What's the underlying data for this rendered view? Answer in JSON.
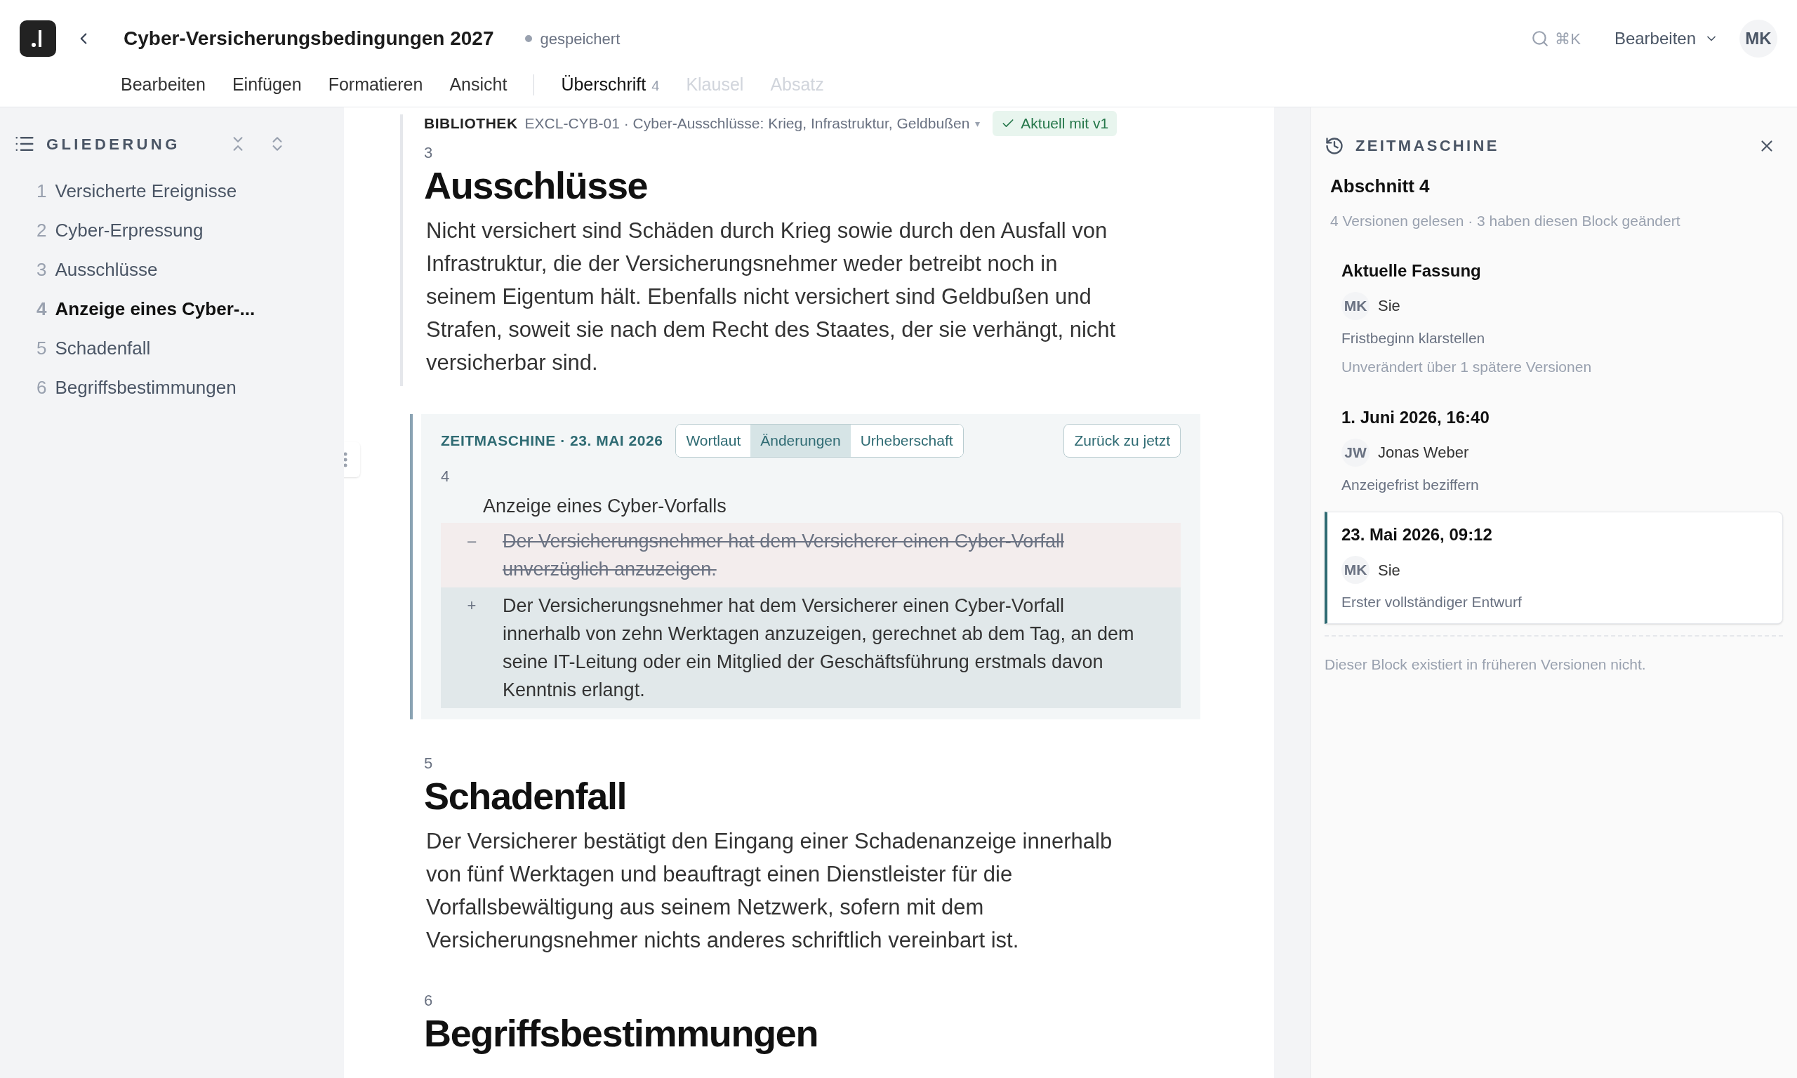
{
  "document": {
    "title": "Cyber-Versicherungsbedingungen 2027",
    "status": "gespeichert"
  },
  "search": {
    "shortcut": "⌘K"
  },
  "mode_menu": {
    "label": "Bearbeiten"
  },
  "user": {
    "initials": "MK"
  },
  "menu": [
    "Bearbeiten",
    "Einfügen",
    "Formatieren",
    "Ansicht"
  ],
  "block_types": [
    {
      "label": "Überschrift",
      "count": "4",
      "selected": true,
      "disabled": false
    },
    {
      "label": "Klausel",
      "selected": false,
      "disabled": true
    },
    {
      "label": "Absatz",
      "selected": false,
      "disabled": true
    }
  ],
  "outline": {
    "title": "GLIEDERUNG",
    "items": [
      {
        "number": "1",
        "label": "Versicherte Ereignisse",
        "selected": false
      },
      {
        "number": "2",
        "label": "Cyber-Erpressung",
        "selected": false
      },
      {
        "number": "3",
        "label": "Ausschlüsse",
        "selected": false
      },
      {
        "number": "4",
        "label": "Anzeige eines Cyber-...",
        "selected": true
      },
      {
        "number": "5",
        "label": "Schadenfall",
        "selected": false
      },
      {
        "number": "6",
        "label": "Begriffsbestimmungen",
        "selected": false
      }
    ]
  },
  "sections": [
    {
      "kind": "heading",
      "number": "3",
      "title": "Ausschlüsse",
      "text": "Nicht versichert sind Schäden durch Krieg sowie durch den Ausfall von Infrastruktur, die der Versicherungsnehmer weder betreibt noch in seinem Eigentum hält. Ebenfalls nicht versichert sind Geldbußen und Strafen, soweit sie nach dem Recht des Staates, der sie verhängt, nicht versicherbar sind.",
      "library": {
        "label": "BIBLIOTHEK",
        "reference": "EXCL-CYB-01 · Cyber-Ausschlüsse: Krieg, Infrastruktur, Geldbußen",
        "status": "Aktuell mit v1",
        "caret": "▾"
      }
    },
    {
      "kind": "history",
      "header": "ZEITMASCHINE · 23. MAI 2026",
      "tabs": [
        {
          "label": "Wortlaut",
          "selected": false
        },
        {
          "label": "Änderungen",
          "selected": true
        },
        {
          "label": "Urheberschaft",
          "selected": false
        }
      ],
      "button": "Zurück zu jetzt",
      "number": "4",
      "title": "Anzeige eines Cyber-Vorfalls",
      "changes": [
        {
          "kind": "removed",
          "sign": "–",
          "text": "Der Versicherungsnehmer hat dem Versicherer einen Cyber-Vorfall unverzüglich anzuzeigen."
        },
        {
          "kind": "added",
          "sign": "+",
          "text": "Der Versicherungsnehmer hat dem Versicherer einen Cyber-Vorfall innerhalb von zehn Werktagen anzuzeigen, gerechnet ab dem Tag, an dem seine IT-Leitung oder ein Mitglied der Geschäftsführung erstmals davon Kenntnis erlangt."
        }
      ]
    },
    {
      "kind": "heading",
      "number": "5",
      "title": "Schadenfall",
      "text": "Der Versicherer bestätigt den Eingang einer Schadenanzeige innerhalb von fünf Werktagen und beauftragt einen Dienstleister für die Vorfallsbewältigung aus seinem Netzwerk, sofern mit dem Versicherungsnehmer nichts anderes schriftlich vereinbart ist."
    },
    {
      "kind": "heading",
      "number": "6",
      "title": "Begriffsbestimmungen"
    }
  ],
  "history_panel": {
    "title": "ZEITMASCHINE",
    "block": "Abschnitt 4",
    "summary": "4 Versionen gelesen · 3 haben diesen Block geändert",
    "versions": [
      {
        "title": "Aktuelle Fassung",
        "initials": "MK",
        "author": "Sie",
        "message": "Fristbeginn klarstellen",
        "note": "Unverändert über 1 spätere Versionen",
        "selected": false
      },
      {
        "title": "1. Juni 2026, 16:40",
        "initials": "JW",
        "author": "Jonas Weber",
        "message": "Anzeigefrist beziffern",
        "selected": false
      },
      {
        "title": "23. Mai 2026, 09:12",
        "initials": "MK",
        "author": "Sie",
        "message": "Erster vollständiger Entwurf",
        "selected": true
      }
    ],
    "footer": "Dieser Block existiert in früheren Versionen nicht."
  }
}
